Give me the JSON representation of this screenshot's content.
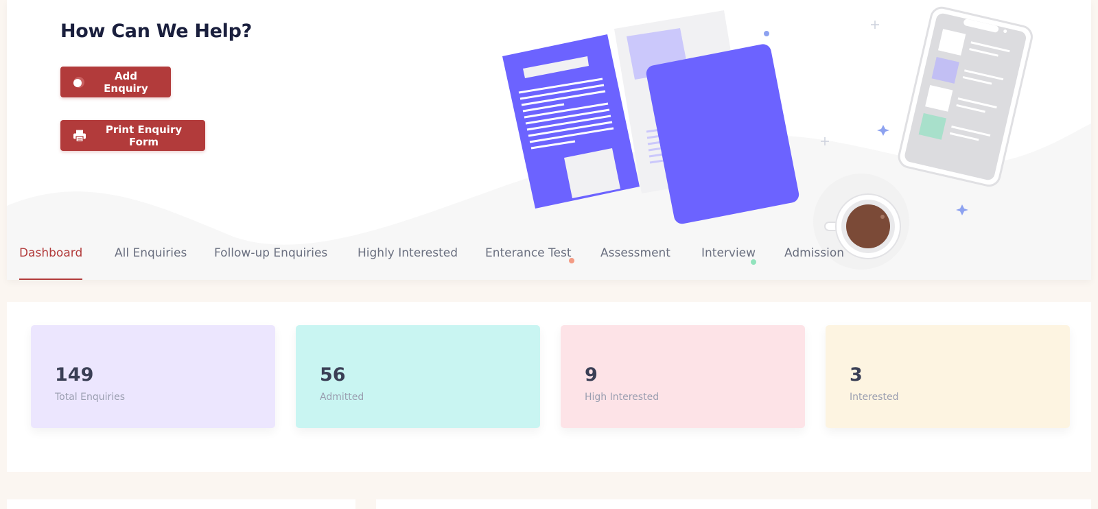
{
  "hero": {
    "title": "How Can We Help?",
    "add_enquiry_label": "Add Enquiry",
    "print_form_label": "Print Enquiry Form"
  },
  "tabs": [
    {
      "label": "Dashboard",
      "active": true
    },
    {
      "label": "All Enquiries",
      "active": false
    },
    {
      "label": "Follow-up Enquiries",
      "active": false
    },
    {
      "label": "Highly Interested",
      "active": false
    },
    {
      "label": "Enterance Test",
      "active": false
    },
    {
      "label": "Assessment",
      "active": false
    },
    {
      "label": "Interview",
      "active": false
    },
    {
      "label": "Admission",
      "active": false
    }
  ],
  "stats": [
    {
      "value": "149",
      "label": "Total Enquiries",
      "color": "#ece6fe"
    },
    {
      "value": "56",
      "label": "Admitted",
      "color": "#c9f5f2"
    },
    {
      "value": "9",
      "label": "High Interested",
      "color": "#fde3e7"
    },
    {
      "value": "3",
      "label": "Interested",
      "color": "#fdf4e1"
    }
  ],
  "colors": {
    "accent": "#b23b3b",
    "illustration_purple": "#6c63ff",
    "coffee": "#7b4a37"
  },
  "icons": {
    "add_enquiry": "circle-plus-icon",
    "print": "printer-icon"
  }
}
